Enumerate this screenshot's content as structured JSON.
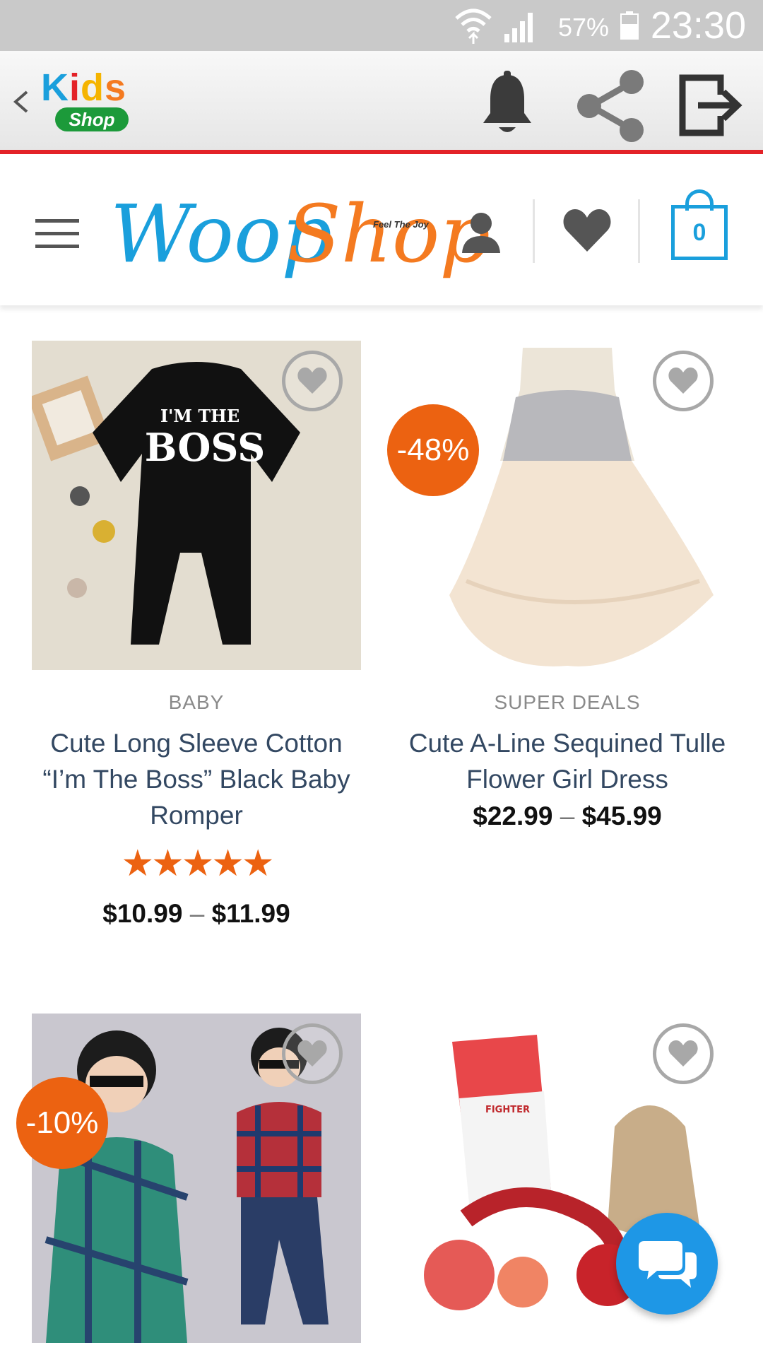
{
  "status_bar": {
    "battery_percent": "57%",
    "time": "23:30",
    "icons": [
      "wifi-icon",
      "signal-icon",
      "battery-icon"
    ]
  },
  "app_bar": {
    "logo_text_top": "Kids",
    "logo_text_bottom": "Shop",
    "icons": [
      "back-icon",
      "bell-icon",
      "share-icon",
      "exit-icon"
    ],
    "accent_color": "#e32228"
  },
  "site_header": {
    "brand_part1": "Woop",
    "brand_part2": "Shop",
    "tagline": "Feel The Joy",
    "cart_count": "0",
    "brand_colors": {
      "blue": "#1a9fdc",
      "orange": "#f47a20"
    }
  },
  "products": [
    {
      "category": "BABY",
      "title": "Cute Long Sleeve Cotton “I’m The Boss” Black Baby Romper",
      "rating_stars": "★★★★★",
      "rating_value": 5,
      "price_min": "$10.99",
      "price_sep": "–",
      "price_max": "$11.99",
      "badge": "",
      "image_text_line1": "I'M THE",
      "image_text_line2": "BOSS"
    },
    {
      "category": "SUPER DEALS",
      "title": "Cute A-Line Sequined Tulle Flower Girl Dress",
      "price_min": "$22.99",
      "price_sep": "–",
      "price_max": "$45.99",
      "badge": "-48%"
    },
    {
      "badge": "-10%"
    },
    {
      "badge": "",
      "image_text": "FIGHTER"
    }
  ],
  "chat_button_icon": "chat-icon",
  "sale_badge_color": "#ec6211"
}
